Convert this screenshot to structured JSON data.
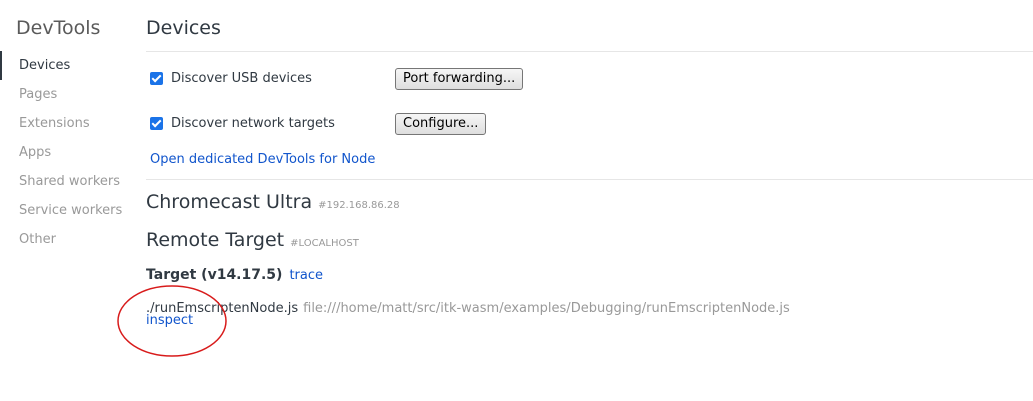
{
  "sidebar": {
    "title": "DevTools",
    "items": [
      {
        "label": "Devices"
      },
      {
        "label": "Pages"
      },
      {
        "label": "Extensions"
      },
      {
        "label": "Apps"
      },
      {
        "label": "Shared workers"
      },
      {
        "label": "Service workers"
      },
      {
        "label": "Other"
      }
    ]
  },
  "main": {
    "title": "Devices",
    "options": [
      {
        "label": "Discover USB devices",
        "checked": true,
        "button": "Port forwarding..."
      },
      {
        "label": "Discover network targets",
        "checked": true,
        "button": "Configure..."
      }
    ],
    "node_link": "Open dedicated DevTools for Node",
    "devices": [
      {
        "name": "Chromecast Ultra",
        "serial": "#192.168.86.28"
      },
      {
        "name": "Remote Target",
        "serial": "#LOCALHOST"
      }
    ],
    "target": {
      "title": "Target (v14.17.5)",
      "trace_label": "trace",
      "name": "./runEmscriptenNode.js",
      "url": "file:///home/matt/src/itk-wasm/examples/Debugging/runEmscriptenNode.js",
      "inspect_label": "inspect"
    }
  },
  "colors": {
    "accent": "#1a73e8",
    "link": "#1155cc",
    "annotation": "#d81b1b"
  }
}
